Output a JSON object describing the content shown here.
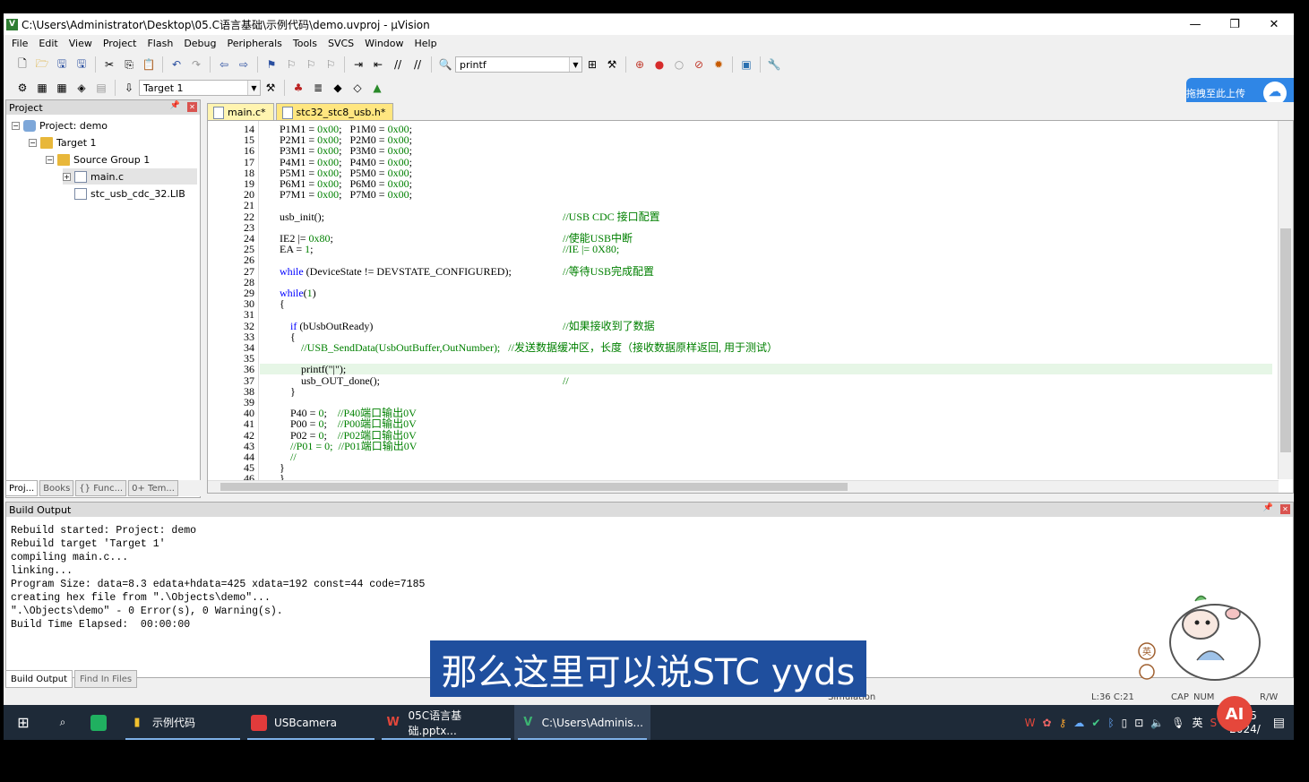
{
  "window": {
    "title": "C:\\Users\\Administrator\\Desktop\\05.C语言基础\\示例代码\\demo.uvproj - µVision",
    "minimize": "—",
    "restore": "❐",
    "close": "✕"
  },
  "menu": [
    "File",
    "Edit",
    "View",
    "Project",
    "Flash",
    "Debug",
    "Peripherals",
    "Tools",
    "SVCS",
    "Window",
    "Help"
  ],
  "toolbar": {
    "find_value": "printf",
    "target_value": "Target 1"
  },
  "upload": {
    "label": "拖拽至此上传"
  },
  "project_panel": {
    "title": "Project",
    "items": [
      {
        "label": "Project: demo"
      },
      {
        "label": "Target 1"
      },
      {
        "label": "Source Group 1"
      },
      {
        "label": "main.c"
      },
      {
        "label": "stc_usb_cdc_32.LIB"
      }
    ],
    "tabs": [
      "Proj...",
      "Books",
      "{} Func...",
      "0+ Tem..."
    ]
  },
  "editor_tabs": [
    "main.c*",
    "stc32_stc8_usb.h*"
  ],
  "code": [
    {
      "n": "14",
      "code": "P1M1 = 0x00;   P1M0 = 0x00;",
      "c": ""
    },
    {
      "n": "15",
      "code": "P2M1 = 0x00;   P2M0 = 0x00;",
      "c": ""
    },
    {
      "n": "16",
      "code": "P3M1 = 0x00;   P3M0 = 0x00;",
      "c": ""
    },
    {
      "n": "17",
      "code": "P4M1 = 0x00;   P4M0 = 0x00;",
      "c": ""
    },
    {
      "n": "18",
      "code": "P5M1 = 0x00;   P5M0 = 0x00;",
      "c": ""
    },
    {
      "n": "19",
      "code": "P6M1 = 0x00;   P6M0 = 0x00;",
      "c": ""
    },
    {
      "n": "20",
      "code": "P7M1 = 0x00;   P7M0 = 0x00;",
      "c": ""
    },
    {
      "n": "21",
      "code": "",
      "c": ""
    },
    {
      "n": "22",
      "code": "usb_init();",
      "c": "//USB CDC 接口配置"
    },
    {
      "n": "23",
      "code": "",
      "c": ""
    },
    {
      "n": "24",
      "code": "IE2 |= 0x80;",
      "c": "//使能USB中断"
    },
    {
      "n": "25",
      "code": "EA = 1;",
      "c": "//IE |= 0X80;"
    },
    {
      "n": "26",
      "code": "",
      "c": ""
    },
    {
      "n": "27",
      "code": "while (DeviceState != DEVSTATE_CONFIGURED);",
      "c": "//等待USB完成配置"
    },
    {
      "n": "28",
      "code": "",
      "c": ""
    },
    {
      "n": "29",
      "code": "while(1)",
      "c": ""
    },
    {
      "n": "30",
      "code": "{",
      "c": ""
    },
    {
      "n": "31",
      "code": "",
      "c": ""
    },
    {
      "n": "32",
      "code": "    if (bUsbOutReady)",
      "c": "//如果接收到了数据"
    },
    {
      "n": "33",
      "code": "    {",
      "c": ""
    },
    {
      "n": "34",
      "code": "        //USB_SendData(UsbOutBuffer,OutNumber);   //发送数据缓冲区，长度（接收数据原样返回, 用于测试）",
      "c": ""
    },
    {
      "n": "35",
      "code": "",
      "c": ""
    },
    {
      "n": "36",
      "code": "        printf(\"|\");",
      "c": ""
    },
    {
      "n": "37",
      "code": "        usb_OUT_done();",
      "c": "//"
    },
    {
      "n": "38",
      "code": "    }",
      "c": ""
    },
    {
      "n": "39",
      "code": "",
      "c": ""
    },
    {
      "n": "40",
      "code": "    P40 = 0;    //P40端口输出0V",
      "c": ""
    },
    {
      "n": "41",
      "code": "    P00 = 0;    //P00端口输出0V",
      "c": ""
    },
    {
      "n": "42",
      "code": "    P02 = 0;    //P02端口输出0V",
      "c": ""
    },
    {
      "n": "43",
      "code": "    //P01 = 0;  //P01端口输出0V",
      "c": ""
    },
    {
      "n": "44",
      "code": "    //",
      "c": ""
    },
    {
      "n": "45",
      "code": "}",
      "c": ""
    },
    {
      "n": "46",
      "code": "}",
      "c": ""
    }
  ],
  "build": {
    "title": "Build Output",
    "text": "Rebuild started: Project: demo\nRebuild target 'Target 1'\ncompiling main.c...\nlinking...\nProgram Size: data=8.3 edata+hdata=425 xdata=192 const=44 code=7185\ncreating hex file from \".\\Objects\\demo\"...\n\".\\Objects\\demo\" - 0 Error(s), 0 Warning(s).\nBuild Time Elapsed:  00:00:00",
    "tabs": [
      "Build Output",
      "Find In Files"
    ]
  },
  "status": {
    "mode": "Simulation",
    "pos": "L:36 C:21",
    "caps": "CAP",
    "num": "NUM",
    "rw": "R/W"
  },
  "subtitle": "那么这里可以说STC yyds",
  "taskbar": {
    "items": [
      "示例代码",
      "USBcamera",
      "05C语言基础.pptx...",
      "C:\\Users\\Adminis..."
    ],
    "ime": "英",
    "time": "21:5",
    "date": "2024/"
  },
  "ai_button": "AI",
  "mascot_label": "英"
}
